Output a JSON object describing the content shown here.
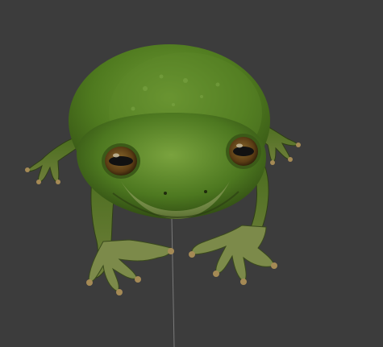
{
  "app": {
    "view": "3d-viewport",
    "subject": "frog-model",
    "colors": {
      "background": "#3c3c3c",
      "grid_line": "#444444",
      "skin_dark": "#2f4a12",
      "skin_mid": "#4f7a1f",
      "skin_light": "#6f9a35",
      "belly": "#b7c08a",
      "eye_iris": "#6a4a1a",
      "eye_pupil": "#111111",
      "toe_tip": "#a58a55"
    },
    "icons": {
      "frog": "frog-model"
    }
  }
}
